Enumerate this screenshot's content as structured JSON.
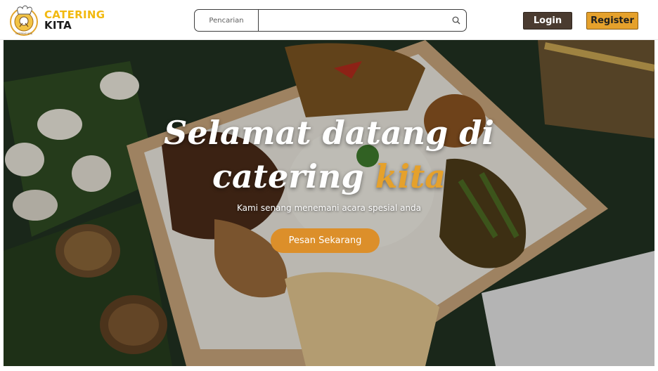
{
  "header": {
    "brand_line1": "CATERING",
    "brand_line2": "KITA",
    "logo_ring_text": "CATERING KITA",
    "logo_icon": "chef-hat-logo",
    "search_label": "Pencarian",
    "search_value": "",
    "search_placeholder": "",
    "search_icon": "search-icon",
    "login_label": "Login",
    "register_label": "Register"
  },
  "hero": {
    "title_part1": "Selamat datang di",
    "title_part2": "catering",
    "title_accent": "kita",
    "subtitle": "Kami senang menemani acara spesial anda",
    "cta_label": "Pesan Sekarang"
  },
  "colors": {
    "brand_yellow": "#f2b90f",
    "accent_orange": "#e5a12c",
    "cta_orange": "#dc8f2a",
    "login_brown": "#4a3b30",
    "dark_text": "#1c1c1c"
  }
}
